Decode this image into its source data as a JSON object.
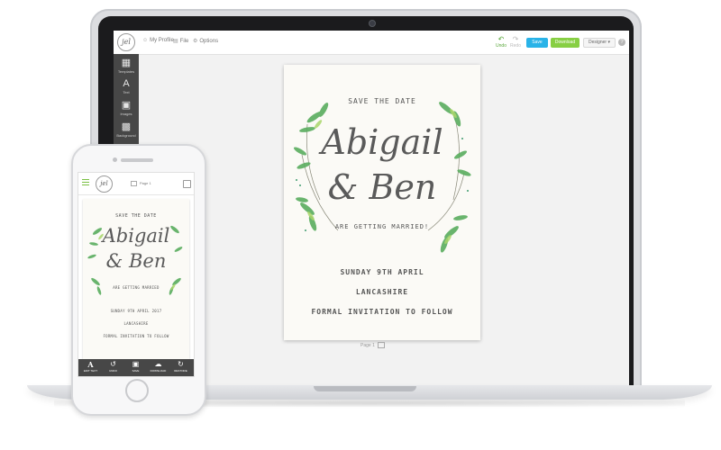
{
  "desktop": {
    "logo_text": "jel",
    "menu": [
      {
        "label": "My Profile",
        "icon": "user-icon"
      },
      {
        "label": "File",
        "icon": "file-icon"
      },
      {
        "label": "Options",
        "icon": "options-icon"
      }
    ],
    "undo_label": "Undo",
    "redo_label": "Redo",
    "save_label": "Save",
    "download_label": "Download",
    "designer_label": "Designer",
    "sidebar": [
      {
        "label": "Templates",
        "icon": "templates-icon"
      },
      {
        "label": "Text",
        "icon": "text-icon"
      },
      {
        "label": "Images",
        "icon": "images-icon"
      },
      {
        "label": "Background",
        "icon": "background-icon"
      }
    ],
    "page_label": "Page 1",
    "colors": {
      "save": "#29b3e8",
      "download": "#87cf43",
      "sidebar": "#474747",
      "leaf": "#4aa85a"
    }
  },
  "invitation": {
    "save_the_date": "SAVE THE DATE",
    "name1": "Abigail",
    "amp_name2": "& Ben",
    "getting_married": "ARE GETTING MARRIED!",
    "date": "SUNDAY 9TH APRIL",
    "place": "LANCASHIRE",
    "follow": "FORMAL INVITATION TO FOLLOW"
  },
  "mobile": {
    "logo_text": "jel",
    "page_label": "Page 1",
    "invitation": {
      "save_the_date": "SAVE THE DATE",
      "name1": "Abigail",
      "amp_name2": "& Ben",
      "getting_married": "ARE GETTING MARRIED",
      "date": "SUNDAY 9TH APRIL 2017",
      "place": "LANCASHIRE",
      "follow": "FORMAL INVITATION TO FOLLOW"
    },
    "toolbar": [
      {
        "label": "EDIT TEXT",
        "icon": "text-icon"
      },
      {
        "label": "UNDO",
        "icon": "undo-icon"
      },
      {
        "label": "SAVE",
        "icon": "save-icon"
      },
      {
        "label": "DOWNLOAD",
        "icon": "cloud-download-icon"
      },
      {
        "label": "RESTORE",
        "icon": "restore-icon"
      }
    ]
  }
}
